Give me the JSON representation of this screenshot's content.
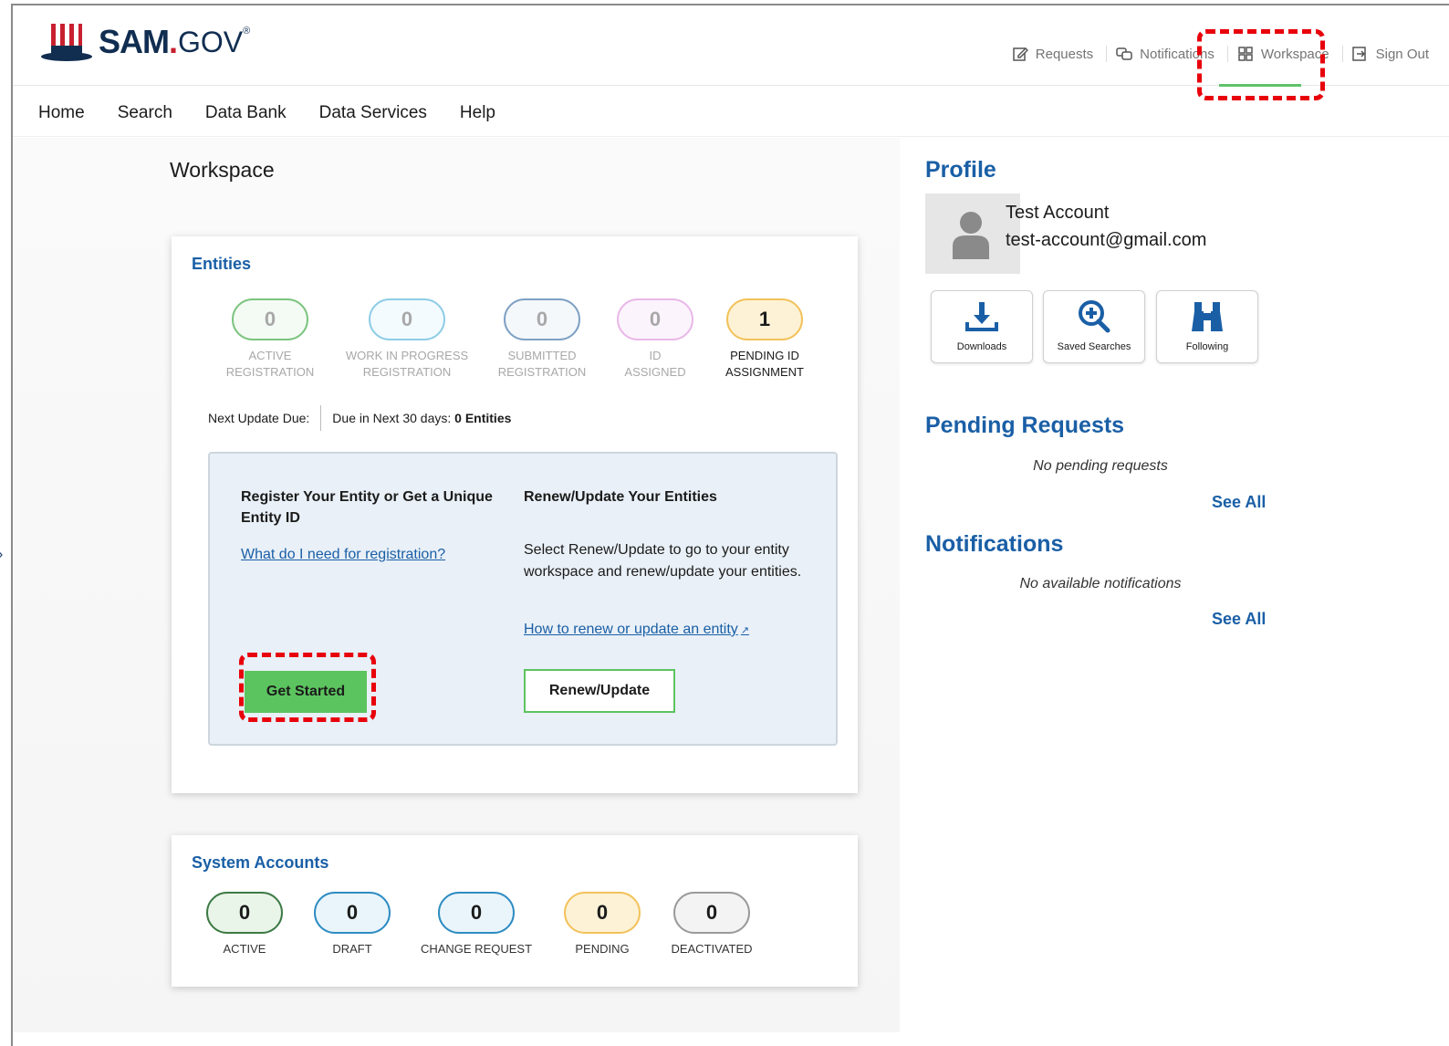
{
  "header": {
    "logo_sam": "SAM",
    "logo_dot": ".",
    "logo_gov": "GOV",
    "logo_reg": "®",
    "links": {
      "requests": "Requests",
      "notifications": "Notifications",
      "workspace": "Workspace",
      "signout": "Sign Out"
    }
  },
  "nav": {
    "items": [
      "Home",
      "Search",
      "Data Bank",
      "Data Services",
      "Help"
    ]
  },
  "page_title": "Workspace",
  "entities": {
    "title": "Entities",
    "stats": [
      {
        "value": "0",
        "label1": "ACTIVE",
        "label2": "REGISTRATION",
        "color": "#7cc47f"
      },
      {
        "value": "0",
        "label1": "WORK IN PROGRESS",
        "label2": "REGISTRATION",
        "color": "#8ecde6"
      },
      {
        "value": "0",
        "label1": "SUBMITTED",
        "label2": "REGISTRATION",
        "color": "#7ea1c4"
      },
      {
        "value": "0",
        "label1": "ID",
        "label2": "ASSIGNED",
        "color": "#e9b8e8"
      },
      {
        "value": "1",
        "label1": "PENDING ID",
        "label2": "ASSIGNMENT",
        "color": "#f2c25b"
      }
    ],
    "next_update_label": "Next Update Due:",
    "due_text": "Due in Next 30 days:",
    "due_count": "0 Entities",
    "register_title": "Register Your Entity or Get a Unique Entity ID",
    "register_link": "What do I need for registration?",
    "get_started": "Get Started",
    "renew_title": "Renew/Update Your Entities",
    "renew_desc": "Select Renew/Update to go to your entity workspace and renew/update your entities.",
    "renew_link": "How to renew or update an entity",
    "renew_button": "Renew/Update"
  },
  "system_accounts": {
    "title": "System Accounts",
    "stats": [
      {
        "value": "0",
        "label": "ACTIVE",
        "color": "#3d7a45"
      },
      {
        "value": "0",
        "label": "DRAFT",
        "color": "#2e8cc2"
      },
      {
        "value": "0",
        "label": "CHANGE REQUEST",
        "color": "#2e8cc2"
      },
      {
        "value": "0",
        "label": "PENDING",
        "color": "#f2c25b"
      },
      {
        "value": "0",
        "label": "DEACTIVATED",
        "color": "#9a9a9a"
      }
    ]
  },
  "profile": {
    "title": "Profile",
    "name": "Test Account",
    "email": "test-account@gmail.com",
    "tiles": {
      "downloads": "Downloads",
      "saved_searches": "Saved Searches",
      "following": "Following"
    }
  },
  "pending_requests": {
    "title": "Pending Requests",
    "empty": "No pending requests",
    "see_all": "See All"
  },
  "notifications": {
    "title": "Notifications",
    "empty": "No available notifications",
    "see_all": "See All"
  },
  "colors": {
    "brand_blue": "#1a5fa6",
    "green": "#5cc45f",
    "highlight_red": "#e8000b"
  }
}
